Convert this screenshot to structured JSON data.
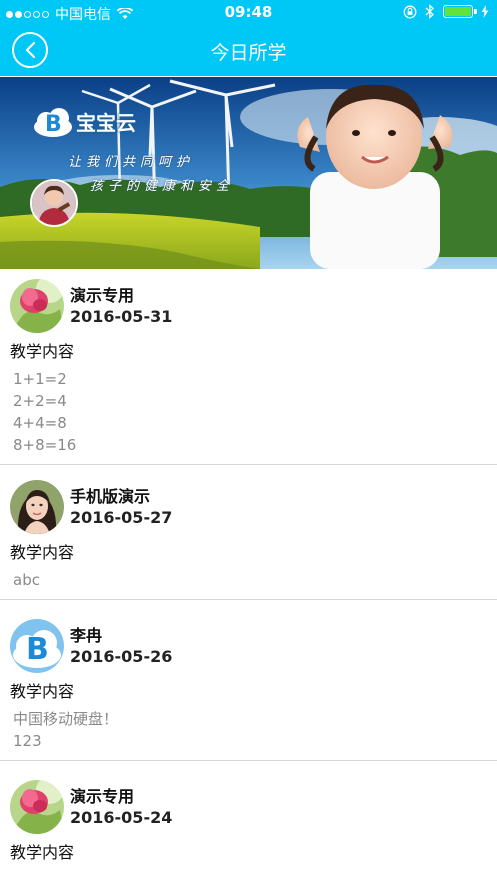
{
  "status_bar": {
    "carrier": "中国电信",
    "time": "09:48"
  },
  "nav": {
    "title": "今日所学"
  },
  "banner": {
    "brand_logo_letter": "B",
    "brand_name": "宝宝云",
    "slogan_line1": "让我们共同呵护",
    "slogan_line2": "孩子的健康和安全"
  },
  "posts": [
    {
      "author": "演示专用",
      "date": "2016-05-31",
      "section_label": "教学内容",
      "lines": [
        "1+1=2",
        "2+2=4",
        "4+4=8",
        "8+8=16"
      ],
      "avatar": "flower-icon"
    },
    {
      "author": "手机版演示",
      "date": "2016-05-27",
      "section_label": "教学内容",
      "lines": [
        "abc"
      ],
      "avatar": "woman-photo-icon"
    },
    {
      "author": "李冉",
      "date": "2016-05-26",
      "section_label": "教学内容",
      "lines": [
        "中国移动硬盘！",
        "123"
      ],
      "avatar": "brand-logo-icon",
      "avatar_letter": "B"
    },
    {
      "author": "演示专用",
      "date": "2016-05-24",
      "section_label": "教学内容",
      "lines": [],
      "avatar": "flower-icon"
    }
  ],
  "colors": {
    "header_blue": "#00c8f6",
    "battery_green": "#63e23a",
    "secondary_text": "#8a8a8a"
  }
}
